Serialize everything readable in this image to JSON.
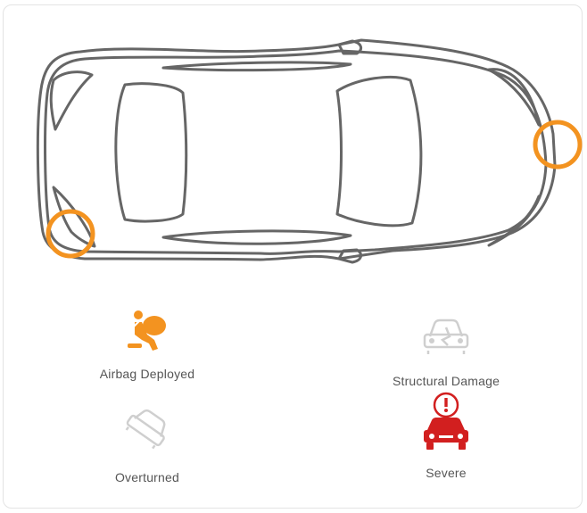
{
  "diagram": {
    "name": "vehicle-top-view",
    "impact_color": "#f39320",
    "outline_color": "#666666"
  },
  "indicators": [
    {
      "id": "airbag",
      "label": "Airbag Deployed",
      "icon": "airbag-icon",
      "status": "active",
      "color": "#f39320"
    },
    {
      "id": "structural",
      "label": "Structural Damage",
      "icon": "car-damage-icon",
      "status": "inactive",
      "color": "#cfcfcf"
    },
    {
      "id": "overturned",
      "label": "Overturned",
      "icon": "overturned-car-icon",
      "status": "inactive",
      "color": "#cfcfcf"
    },
    {
      "id": "severe",
      "label": "Severe",
      "icon": "car-alert-icon",
      "status": "active",
      "color": "#d21f1f"
    }
  ]
}
